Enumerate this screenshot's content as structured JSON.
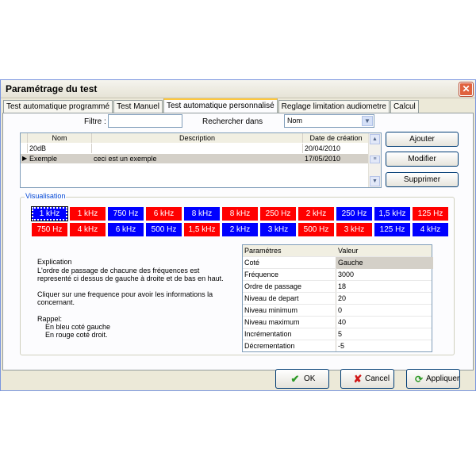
{
  "window": {
    "title": "Paramétrage du test",
    "close_glyph": "✕"
  },
  "tabs": [
    {
      "label": "Test automatique programmé"
    },
    {
      "label": "Test Manuel"
    },
    {
      "label": "Test automatique personnalisé"
    },
    {
      "label": "Reglage limitation audiometre"
    },
    {
      "label": "Calcul"
    }
  ],
  "active_tab": "Test automatique personnalisé",
  "filters": {
    "filtre_label": "Filtre :",
    "filtre_value": "",
    "search_label": "Rechercher dans",
    "search_value": "Nom"
  },
  "grid": {
    "columns": [
      "Nom",
      "Description",
      "Date de création"
    ],
    "rows": [
      {
        "marker": "",
        "nom": "20dB",
        "description": "",
        "date": "20/04/2010"
      },
      {
        "marker": "▶",
        "nom": "Exemple",
        "description": "ceci est un exemple",
        "date": "17/05/2010"
      }
    ]
  },
  "actions": {
    "add": "Ajouter",
    "edit": "Modifier",
    "delete": "Supprimer"
  },
  "visualisation": {
    "label": "Visualisation",
    "row1": [
      {
        "label": "1 kHz",
        "color": "blue"
      },
      {
        "label": "1 kHz",
        "color": "red"
      },
      {
        "label": "750 Hz",
        "color": "blue"
      },
      {
        "label": "6 kHz",
        "color": "red"
      },
      {
        "label": "8 kHz",
        "color": "blue"
      },
      {
        "label": "8 kHz",
        "color": "red"
      },
      {
        "label": "250 Hz",
        "color": "red"
      },
      {
        "label": "2 kHz",
        "color": "red"
      },
      {
        "label": "250 Hz",
        "color": "blue"
      },
      {
        "label": "1,5 kHz",
        "color": "blue"
      },
      {
        "label": "125 Hz",
        "color": "red"
      }
    ],
    "row2": [
      {
        "label": "750 Hz",
        "color": "red"
      },
      {
        "label": "4 kHz",
        "color": "red"
      },
      {
        "label": "6 kHz",
        "color": "blue"
      },
      {
        "label": "500 Hz",
        "color": "blue"
      },
      {
        "label": "1,5 kHz",
        "color": "red"
      },
      {
        "label": "2 kHz",
        "color": "blue"
      },
      {
        "label": "3 kHz",
        "color": "blue"
      },
      {
        "label": "500 Hz",
        "color": "red"
      },
      {
        "label": "3 kHz",
        "color": "red"
      },
      {
        "label": "125 Hz",
        "color": "blue"
      },
      {
        "label": "4 kHz",
        "color": "blue"
      }
    ],
    "colors": {
      "blue": "#0000ff",
      "red": "#ff0000"
    }
  },
  "explanation": {
    "lines": [
      "Explication",
      "L'ordre de passage de chacune des fréquences est",
      "representé ci dessus de gauche à droite et de bas en haut.",
      "",
      "Cliquer sur une frequence pour avoir les informations la",
      "concernant.",
      "",
      "Rappel:",
      "    En bleu coté gauche",
      "    En rouge coté droit."
    ]
  },
  "params": {
    "header_key": "Paramétres",
    "header_value": "Valeur",
    "rows": [
      {
        "key": "Coté",
        "value": "Gauche"
      },
      {
        "key": "Fréquence",
        "value": "3000"
      },
      {
        "key": "Ordre de passage",
        "value": "18"
      },
      {
        "key": "Niveau de depart",
        "value": "20"
      },
      {
        "key": "Niveau minimum",
        "value": "0"
      },
      {
        "key": "Niveau maximum",
        "value": "40"
      },
      {
        "key": "Incrémentation",
        "value": "5"
      },
      {
        "key": "Décrementation",
        "value": "-5"
      }
    ]
  },
  "footer": {
    "ok": "OK",
    "cancel": "Cancel",
    "apply": "Appliquer"
  }
}
